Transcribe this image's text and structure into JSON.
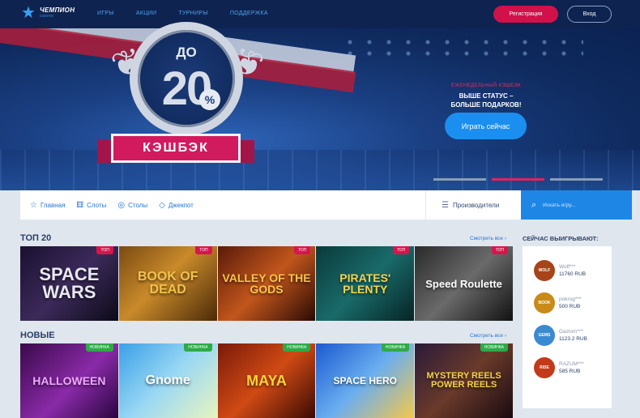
{
  "header": {
    "logo_title": "ЧЕМПИОН",
    "logo_sub": "casino",
    "nav": [
      "ИГРЫ",
      "АКЦИИ",
      "ТУРНИРЫ",
      "ПОДДЕРЖКА"
    ],
    "register_label": "Регистрация",
    "login_label": "Вход"
  },
  "banner": {
    "badge_prefix": "ДО",
    "badge_number": "20",
    "badge_percent": "%",
    "ribbon_text": "КЭШБЭК",
    "promo_subtitle": "ЕЖЕНЕДЕЛЬНЫЙ КЭШБЭК",
    "promo_title_line1": "ВЫШЕ СТАТУС –",
    "promo_title_line2": "БОЛЬШЕ ПОДАРКОВ!",
    "play_label": "Играть сейчас",
    "slides": 3,
    "active_slide": 2
  },
  "filters": {
    "items": [
      {
        "label": "Главная",
        "icon": "star-icon"
      },
      {
        "label": "Слоты",
        "icon": "dice-icon"
      },
      {
        "label": "Столы",
        "icon": "chips-icon"
      },
      {
        "label": "Джекпот",
        "icon": "diamond-icon"
      }
    ],
    "providers_label": "Производители",
    "search_placeholder": "Искать игру..."
  },
  "top": {
    "title": "ТОП 20",
    "see_all": "Смотреть все ›",
    "tag": "ТОП",
    "games": [
      {
        "name": "SPACE WARS",
        "bg": "linear-gradient(135deg,#1a1030,#3c2a5a 50%,#0c0a18)",
        "color": "#e8e8f0"
      },
      {
        "name": "BOOK OF DEAD",
        "bg": "linear-gradient(135deg,#7a4a12,#c98a2a 45%,#4a2a08)",
        "color": "#f3c34a"
      },
      {
        "name": "VALLEY OF THE GODS",
        "bg": "linear-gradient(135deg,#5a1a0a,#c2561c 50%,#2a0a04)",
        "color": "#f7c54a"
      },
      {
        "name": "PIRATES' PLENTY",
        "bg": "linear-gradient(135deg,#0a3a3a,#1a6a6a 50%,#062424)",
        "color": "#f4d34a"
      },
      {
        "name": "Speed Roulette",
        "bg": "linear-gradient(135deg,#2a2a2a,#6a6a6a 50%,#111)",
        "color": "#ffffff"
      }
    ]
  },
  "new": {
    "title": "НОВЫЕ",
    "see_all": "Смотреть все ›",
    "tag": "НОВИНКА",
    "games": [
      {
        "name": "HALLOWEEN",
        "bg": "linear-gradient(135deg,#3a0a4a,#8a2aa8 55%,#2a0640)",
        "color": "#f0a8ff"
      },
      {
        "name": "Gnome",
        "bg": "linear-gradient(135deg,#3aa0e8,#9ad8f4 50%,#e8f4c0)",
        "color": "#ffffff"
      },
      {
        "name": "MAYA",
        "bg": "linear-gradient(135deg,#7a1a0a,#d04a14 50%,#3a0a04)",
        "color": "#ffd23a"
      },
      {
        "name": "SPACE HERO",
        "bg": "linear-gradient(135deg,#1a5ad0,#6aaef0 50%,#f4c84a)",
        "color": "#ffffff"
      },
      {
        "name": "MYSTERY REELS POWER REELS",
        "bg": "linear-gradient(135deg,#2a1a3a,#6a3a2a 50%,#1a0a10)",
        "color": "#f4d34a"
      }
    ]
  },
  "winners": {
    "title": "СЕЙЧАС ВЫИГРЫВАЮТ:",
    "list": [
      {
        "name": "Wolf***",
        "amount": "11760 RUB",
        "color": "#a8431a",
        "game": "WOLF"
      },
      {
        "name": "pokrug***",
        "amount": "500 RUB",
        "color": "#c98a1a",
        "game": "BOOK"
      },
      {
        "name": "Gazlom***",
        "amount": "1123.2 RUB",
        "color": "#3a8ad0",
        "game": "GEMS"
      },
      {
        "name": "RAZUM***",
        "amount": "585 RUB",
        "color": "#c23a1a",
        "game": "RISE"
      }
    ]
  }
}
